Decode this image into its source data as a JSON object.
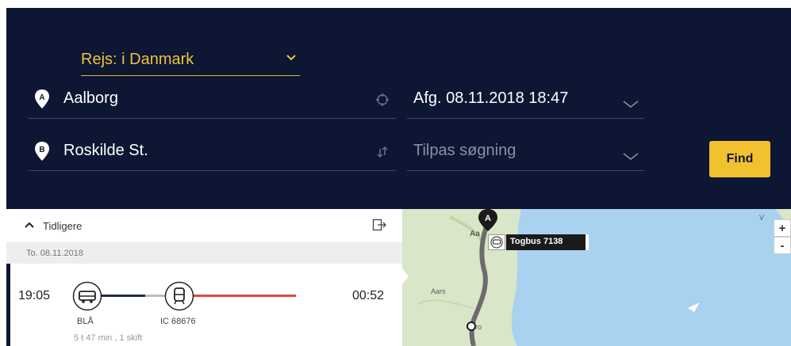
{
  "search": {
    "trip_type": "Rejs: i Danmark",
    "from": "Aalborg",
    "to": "Roskilde St.",
    "departure": "Afg. 08.11.2018 18:47",
    "options_placeholder": "Tilpas søgning",
    "find_label": "Find"
  },
  "results": {
    "earlier_label": "Tidligere",
    "date": "To. 08.11.2018",
    "journey": {
      "departure": "19:05",
      "arrival": "00:52",
      "legs": [
        {
          "mode": "bus-icon",
          "name": "BLÅ"
        },
        {
          "mode": "train-icon",
          "name": "IC 68676"
        }
      ],
      "summary": "5 t 47 min , 1 skift"
    }
  },
  "map": {
    "start_marker": "A",
    "tooltip": "Togbus 7138",
    "labels": {
      "city_partial": "Aa",
      "town": "Aars",
      "ro_fragment": "ro",
      "top_right": "V"
    },
    "zoom_in": "+",
    "zoom_out": "-",
    "colors": {
      "land": "#d9e6c7",
      "water": "#a9d2f1",
      "route": "#6c6c6c"
    }
  },
  "colors": {
    "header": "#0d1733",
    "accent": "#f2c12e",
    "route_red": "#e7463a"
  }
}
